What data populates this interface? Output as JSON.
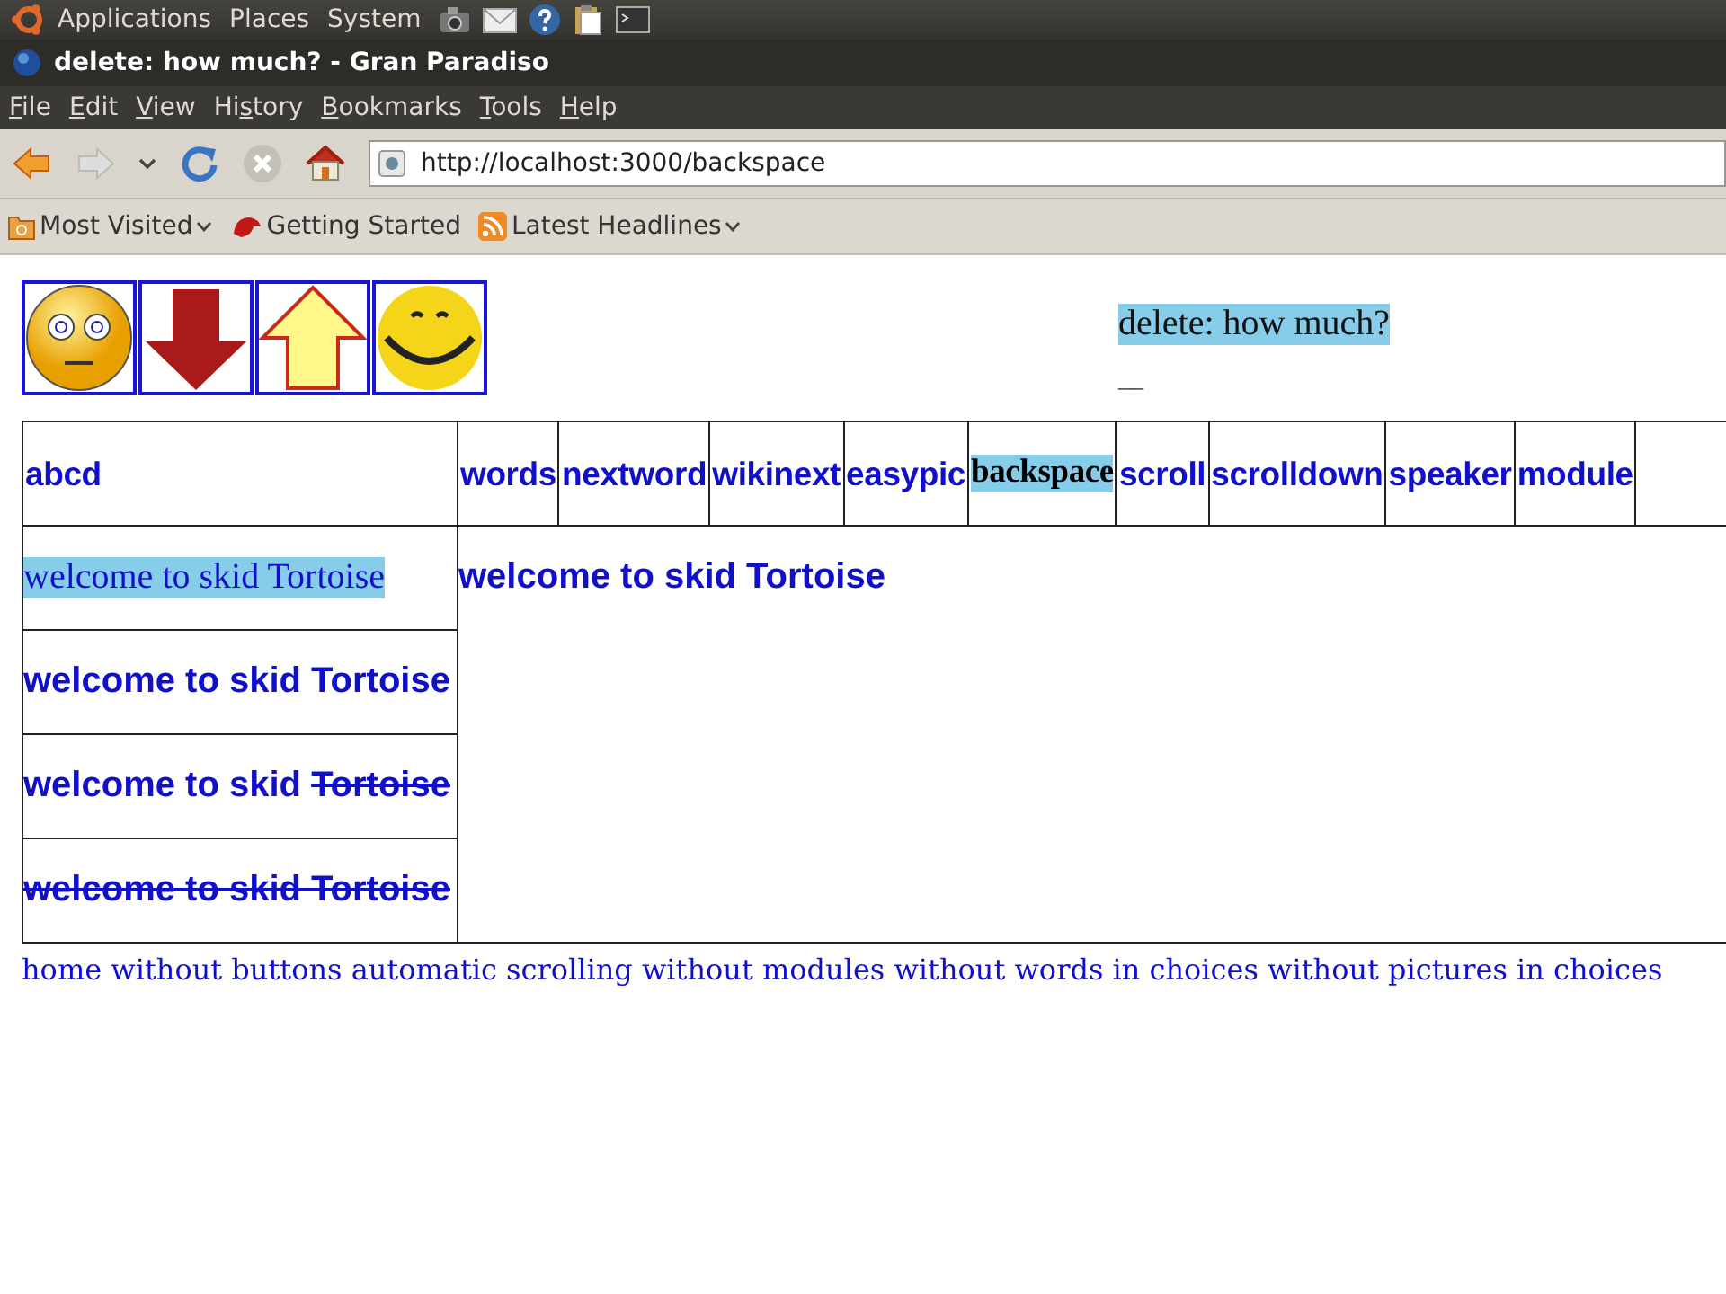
{
  "top_panel": {
    "menus": [
      "Applications",
      "Places",
      "System"
    ]
  },
  "window": {
    "title": "delete: how much? - Gran Paradiso"
  },
  "menu_bar": [
    {
      "key": "F",
      "after": "ile"
    },
    {
      "key": "E",
      "after": "dit"
    },
    {
      "key": "V",
      "after": "iew"
    },
    {
      "before": "Hi",
      "key": "s",
      "after": "tory"
    },
    {
      "key": "B",
      "after": "ookmarks"
    },
    {
      "key": "T",
      "after": "ools"
    },
    {
      "key": "H",
      "after": "elp"
    }
  ],
  "toolbar": {
    "url": "http://localhost:3000/backspace",
    "forward_disabled": true,
    "stop_disabled": true
  },
  "bookmarks": [
    {
      "label": "Most Visited",
      "kind": "folder"
    },
    {
      "label": "Getting Started",
      "kind": "link"
    },
    {
      "label": "Latest Headlines",
      "kind": "feed"
    }
  ],
  "page": {
    "picture_buttons": [
      {
        "kind": "neutral"
      },
      {
        "kind": "down"
      },
      {
        "kind": "up"
      },
      {
        "kind": "smile"
      }
    ],
    "prompt": "delete: how much?",
    "blank": "__",
    "columns": [
      {
        "label": "abcd",
        "selected": false
      },
      {
        "label": "words",
        "selected": false
      },
      {
        "label": "nextword",
        "selected": false
      },
      {
        "label": "wikinext",
        "selected": false
      },
      {
        "label": "easypic",
        "selected": false
      },
      {
        "label": "backspace",
        "selected": true
      },
      {
        "label": "scroll",
        "selected": false
      },
      {
        "label": "scrolldown",
        "selected": false
      },
      {
        "label": "speaker",
        "selected": false
      },
      {
        "label": "module",
        "selected": false
      }
    ],
    "choices": [
      {
        "selected": true,
        "parts": [
          {
            "text": "welcome to skid Tortoise",
            "struck": false
          }
        ]
      },
      {
        "selected": false,
        "parts": [
          {
            "text": "welcome to skid Tortoise",
            "struck": false
          }
        ]
      },
      {
        "selected": false,
        "parts": [
          {
            "text": "welcome to skid ",
            "struck": false
          },
          {
            "text": "Tortoise",
            "struck": true
          }
        ]
      },
      {
        "selected": false,
        "parts": [
          {
            "text": "welcome to skid Tortoise",
            "struck": true
          }
        ]
      }
    ],
    "preview": "welcome to skid Tortoise",
    "links": [
      "home",
      "without buttons",
      "automatic scrolling",
      "without modules",
      "without words in choices",
      "without pictures in choices"
    ]
  }
}
